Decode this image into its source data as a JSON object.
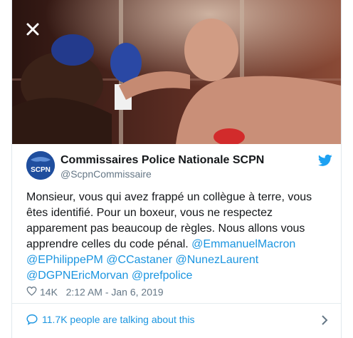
{
  "media": {
    "close_icon": "close-icon"
  },
  "tweet": {
    "author_name": "Commissaires Police Nationale SCPN",
    "author_handle": "@ScpnCommissaire",
    "avatar_label": "SCPN",
    "text_line_1": "Monsieur, vous qui avez frappé un collègue à terre, vous",
    "text_line_2": "êtes identifié. Pour un boxeur, vous ne respectez",
    "text_line_3": "apparement pas beaucoup de règles. Nous allons vous",
    "text_line_4_plain": "apprendre celles du code pénal.",
    "mention_1": "@EmmanuelMacron",
    "mention_2": "@EPhilippePM",
    "mention_3": "@CCastaner",
    "mention_4": "@NunezLaurent",
    "mention_5": "@DGPNEricMorvan",
    "mention_6": "@prefpolice",
    "likes": "14K",
    "timestamp": "2:12 AM - Jan 6, 2019",
    "talking": "11.7K people are talking about this"
  },
  "colors": {
    "link": "#1b95e0",
    "text": "#14171a",
    "muted": "#657786",
    "brand": "#1da1f2"
  }
}
